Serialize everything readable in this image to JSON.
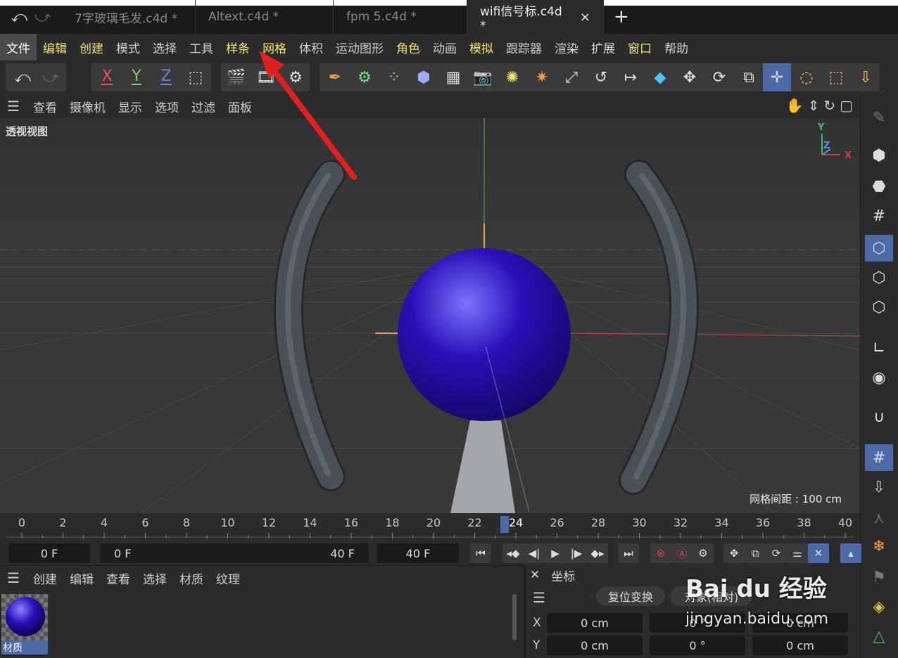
{
  "tabs": [
    {
      "label": "7字玻璃毛发.c4d *"
    },
    {
      "label": "Altext.c4d *"
    },
    {
      "label": "fpm 5.c4d *"
    },
    {
      "label": "wifi信号标.c4d *",
      "active": true
    }
  ],
  "tab_close": "×",
  "tab_add": "+",
  "menu": [
    "文件",
    "编辑",
    "创建",
    "模式",
    "选择",
    "工具",
    "样条",
    "网格",
    "体积",
    "运动图形",
    "角色",
    "动画",
    "模拟",
    "跟踪器",
    "渲染",
    "扩展",
    "窗口",
    "帮助"
  ],
  "toolbar": {
    "x": "X",
    "y": "Y",
    "z": "Z"
  },
  "viewport_menu": [
    "查看",
    "摄像机",
    "显示",
    "选项",
    "过滤",
    "面板"
  ],
  "viewport": {
    "label": "透视视图",
    "grid_spacing": "网格间距 : 100 cm",
    "axis_y": "Y",
    "axis_z": "Z",
    "axis_x": "X",
    "sphere_color": "#2a10b8",
    "tube_color": "#4a5058",
    "arrow_color": "#e02020"
  },
  "timeline": {
    "ticks": [
      "0",
      "2",
      "4",
      "6",
      "8",
      "10",
      "12",
      "14",
      "16",
      "18",
      "20",
      "22",
      "24",
      "26",
      "28",
      "30",
      "32",
      "34",
      "36",
      "38",
      "40"
    ],
    "current": "24"
  },
  "transport": {
    "start": "0 F",
    "range_start": "0 F",
    "range_end": "40 F",
    "end": "40 F"
  },
  "material_menu": [
    "创建",
    "编辑",
    "查看",
    "选择",
    "材质",
    "纹理"
  ],
  "material": {
    "name": "材质"
  },
  "coords": {
    "title": "坐标",
    "reset_button": "复位变换",
    "mode_button": "对象(相对)",
    "rows": [
      {
        "axis": "X",
        "pos": "0 cm",
        "rot": "0 °",
        "size": "0 cm"
      },
      {
        "axis": "Y",
        "pos": "0 cm",
        "rot": "0 °",
        "size": "0 cm"
      }
    ]
  },
  "watermark": {
    "brand": "Bai du 经验",
    "url": "jingyan.baidu.com"
  }
}
